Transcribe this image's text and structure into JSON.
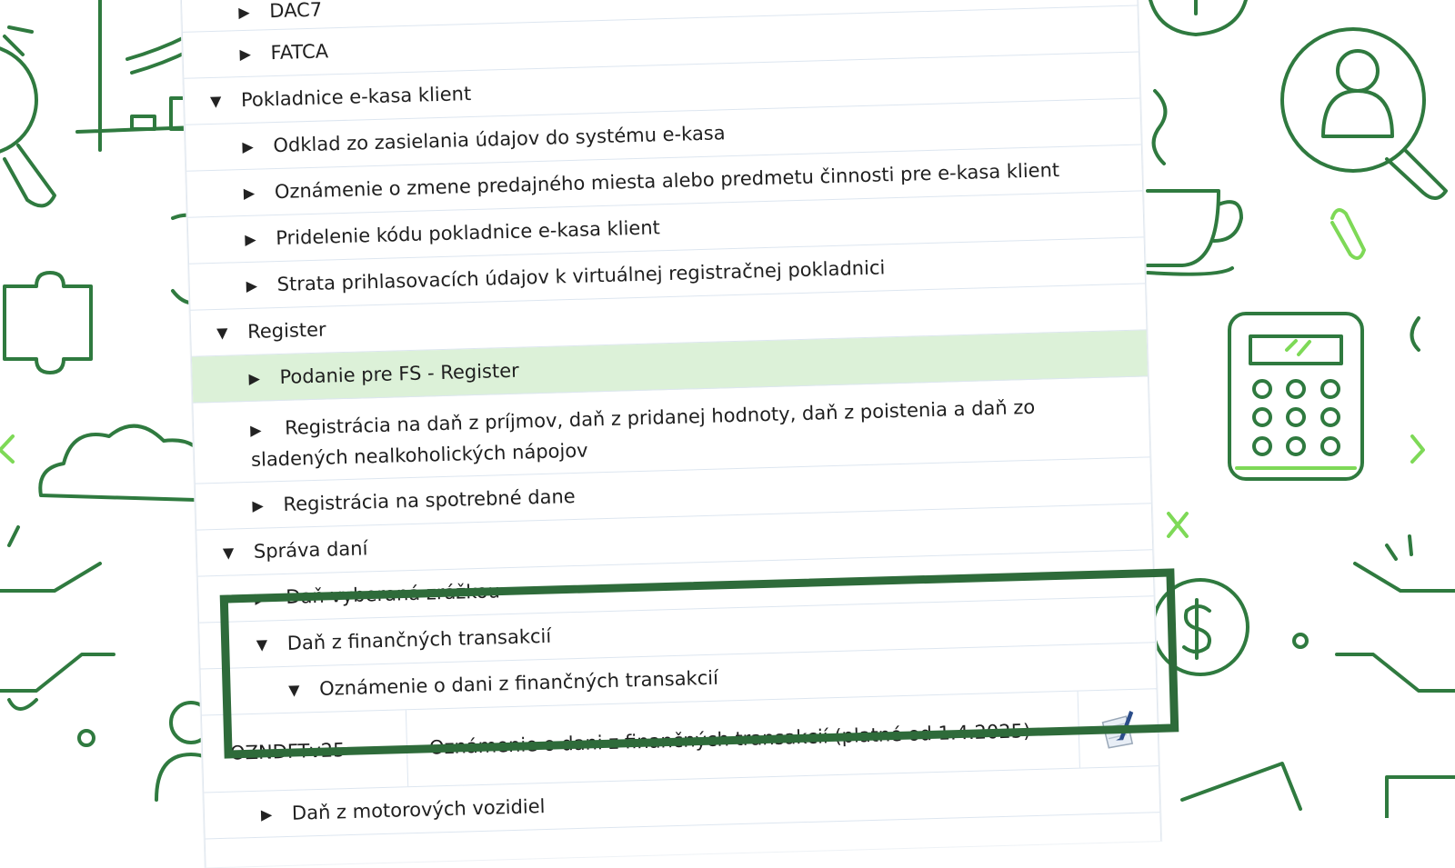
{
  "tree": {
    "items": [
      {
        "label": "DAC7",
        "depth": 1,
        "state": "collapsed"
      },
      {
        "label": "FATCA",
        "depth": 1,
        "state": "collapsed"
      },
      {
        "label": "Pokladnice e-kasa klient",
        "depth": 0,
        "state": "expanded"
      },
      {
        "label": "Odklad zo zasielania údajov do systému e-kasa",
        "depth": 1,
        "state": "collapsed"
      },
      {
        "label": "Oznámenie o zmene predajného miesta alebo predmetu činnosti pre e-kasa klient",
        "depth": 1,
        "state": "collapsed"
      },
      {
        "label": "Pridelenie kódu pokladnice e-kasa klient",
        "depth": 1,
        "state": "collapsed"
      },
      {
        "label": "Strata prihlasovacích údajov k virtuálnej registračnej pokladnici",
        "depth": 1,
        "state": "collapsed"
      },
      {
        "label": "Register",
        "depth": 0,
        "state": "expanded"
      },
      {
        "label": "Podanie pre FS - Register",
        "depth": 1,
        "state": "collapsed",
        "highlighted": true
      },
      {
        "label": "Registrácia na daň z príjmov, daň z pridanej hodnoty, daň z poistenia a daň zo sladených nealkoholických nápojov",
        "depth": 1,
        "state": "collapsed",
        "wrapped": true
      },
      {
        "label": "Registrácia na spotrebné dane",
        "depth": 1,
        "state": "collapsed"
      },
      {
        "label": "Správa daní",
        "depth": 0,
        "state": "expanded"
      },
      {
        "label": "Daň vyberaná zrážkou",
        "depth": 1,
        "state": "collapsed"
      },
      {
        "label": "Daň z finančných transakcií",
        "depth": 1,
        "state": "expanded"
      },
      {
        "label": "Oznámenie o dani z finančných transakcií",
        "depth": 2,
        "state": "expanded"
      }
    ],
    "form_row": {
      "code": "OZNDFTv25",
      "name": "Oznámenie o dani z finančných transakcií (platné od 1.4.2025)",
      "icon": "form-edit-icon"
    },
    "after": [
      {
        "label": "Daň z motorových vozidiel",
        "depth": 1,
        "state": "collapsed"
      }
    ]
  },
  "symbols": {
    "collapsed": "▶",
    "expanded": "▼"
  },
  "colors": {
    "highlight_row": "#dcf1d8",
    "highlight_box": "#2e6b3a",
    "doodle": "#2f7a3f",
    "doodle_accent": "#7ed957"
  }
}
